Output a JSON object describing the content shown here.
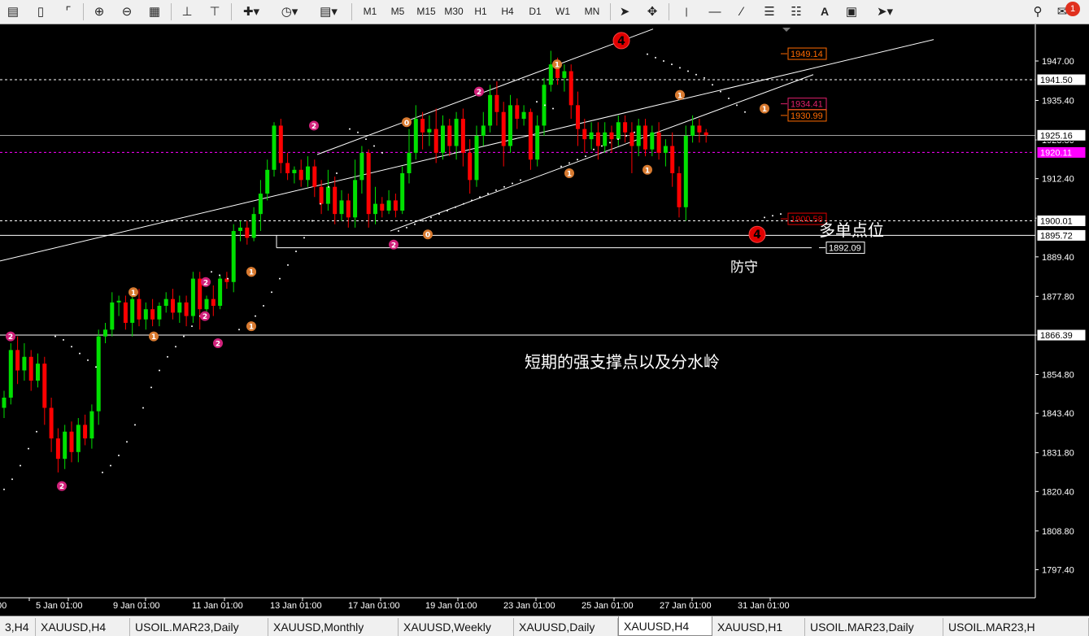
{
  "toolbar": {
    "timeframes": [
      "M1",
      "M5",
      "M15",
      "M30",
      "H1",
      "H4",
      "D1",
      "W1",
      "MN"
    ],
    "text_tool": "A",
    "notification_count": "1"
  },
  "chart": {
    "symbol": "XAUUSD",
    "timeframe": "H4",
    "colors": {
      "bull": "#00e000",
      "bear": "#ff0000",
      "line": "#ffffff",
      "sar": "#ffffff",
      "bid_line": "#ff00ff"
    },
    "price_scale": [
      "1947.00",
      "1935.40",
      "1923.80",
      "1912.40",
      "1900.80",
      "1889.40",
      "1877.80",
      "1866.40",
      "1854.80",
      "1843.40",
      "1831.80",
      "1820.40",
      "1808.80",
      "1797.40"
    ],
    "price_labels": [
      {
        "value": "1941.50",
        "style": "white"
      },
      {
        "value": "1925.16",
        "style": "white"
      },
      {
        "value": "1920.11",
        "style": "magenta"
      },
      {
        "value": "1900.01",
        "style": "white"
      },
      {
        "value": "1895.72",
        "style": "white"
      },
      {
        "value": "1866.39",
        "style": "white"
      }
    ],
    "in_chart_labels": [
      {
        "value": "1949.14",
        "color": "#ff6a00"
      },
      {
        "value": "1934.41",
        "color": "#e0206b"
      },
      {
        "value": "1930.99",
        "color": "#ff6a00"
      },
      {
        "value": "1900.58",
        "color": "#e00000"
      },
      {
        "value": "1892.09",
        "color": "#ffffff"
      }
    ],
    "time_scale": [
      "00",
      "5 Jan 01:00",
      "9 Jan 01:00",
      "11 Jan 01:00",
      "13 Jan 01:00",
      "17 Jan 01:00",
      "19 Jan 01:00",
      "23 Jan 01:00",
      "25 Jan 01:00",
      "27 Jan 01:00",
      "31 Jan 01:00"
    ],
    "annotations": {
      "long_level": "多单点位",
      "defense": "防守",
      "support_note": "短期的强支撑点以及分水岭"
    },
    "wave_markers": [
      {
        "label": "2",
        "kind": "pink"
      },
      {
        "label": "2",
        "kind": "pink"
      },
      {
        "label": "1",
        "kind": "orange"
      },
      {
        "label": "2",
        "kind": "pink"
      },
      {
        "label": "2",
        "kind": "pink"
      },
      {
        "label": "1",
        "kind": "orange"
      },
      {
        "label": "1",
        "kind": "orange"
      },
      {
        "label": "1",
        "kind": "orange"
      },
      {
        "label": "2",
        "kind": "pink"
      },
      {
        "label": "1",
        "kind": "orange"
      },
      {
        "label": "2",
        "kind": "pink"
      },
      {
        "label": "0",
        "kind": "orange"
      },
      {
        "label": "2",
        "kind": "pink"
      },
      {
        "label": "1",
        "kind": "orange"
      },
      {
        "label": "2",
        "kind": "pink"
      },
      {
        "label": "1",
        "kind": "orange"
      },
      {
        "label": "1",
        "kind": "orange"
      },
      {
        "label": "0",
        "kind": "orange"
      },
      {
        "label": "4",
        "kind": "red"
      },
      {
        "label": "1",
        "kind": "orange"
      },
      {
        "label": "1",
        "kind": "orange"
      },
      {
        "label": "1",
        "kind": "orange"
      },
      {
        "label": "4",
        "kind": "red"
      }
    ]
  },
  "tabs": [
    "3,H4",
    "XAUUSD,H4",
    "USOIL.MAR23,Daily",
    "XAUUSD,Monthly",
    "XAUUSD,Weekly",
    "XAUUSD,Daily",
    "XAUUSD,H4",
    "XAUUSD,H1",
    "USOIL.MAR23,Daily",
    "USOIL.MAR23,H"
  ],
  "active_tab": "XAUUSD,H4"
}
